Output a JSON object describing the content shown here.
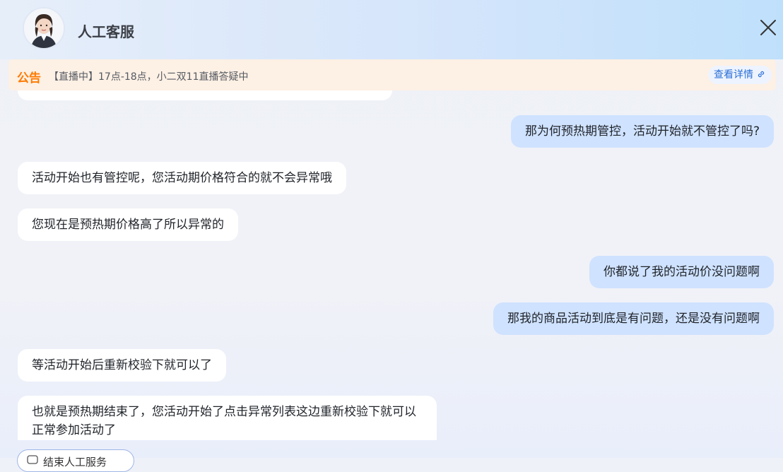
{
  "header": {
    "title": "人工客服"
  },
  "notice": {
    "label": "公告",
    "text": "【直播中】17点-18点，小二双11直播答疑中",
    "link_label": "查看详情"
  },
  "messages": [
    {
      "role": "user",
      "text": "那为何预热期管控，活动开始就不管控了吗?"
    },
    {
      "role": "bot",
      "text": "活动开始也有管控呢，您活动期价格符合的就不会异常哦"
    },
    {
      "role": "bot",
      "text": "您现在是预热期价格高了所以异常的"
    },
    {
      "role": "user",
      "text": "你都说了我的活动价没问题啊"
    },
    {
      "role": "user",
      "text": "那我的商品活动到底是有问题，还是没有问题啊"
    },
    {
      "role": "bot",
      "text": "等活动开始后重新校验下就可以了"
    },
    {
      "role": "bot",
      "text": "也就是预热期结束了，您活动开始了点击异常列表这边重新校验下就可以正常参加活动了"
    }
  ],
  "bottom_chip": {
    "label": "结束人工服务"
  }
}
